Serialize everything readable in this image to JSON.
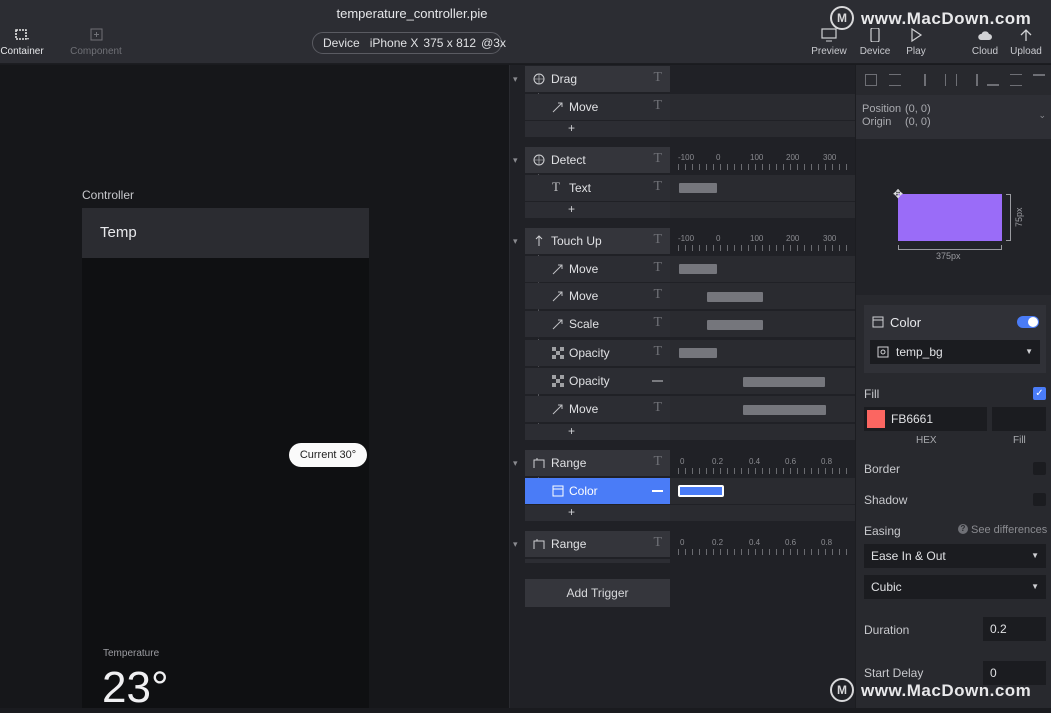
{
  "app": {
    "title": "temperature_controller.pie",
    "watermark": "www.MacDown.com",
    "watermark_logo": "M"
  },
  "toolbar_left": [
    {
      "name": "container",
      "label": "Container",
      "icon": "container-icon"
    },
    {
      "name": "component",
      "label": "Component",
      "icon": "component-icon"
    }
  ],
  "device_selector": {
    "label": "Device",
    "model": "iPhone X",
    "size": "375 x 812",
    "scale": "@3x"
  },
  "toolbar_right": [
    {
      "name": "preview",
      "label": "Preview",
      "icon": "preview-icon"
    },
    {
      "name": "device",
      "label": "Device",
      "icon": "device-icon"
    },
    {
      "name": "play",
      "label": "Play",
      "icon": "play-icon"
    },
    {
      "name": "cloud",
      "label": "Cloud",
      "icon": "cloud-icon"
    },
    {
      "name": "upload",
      "label": "Upload",
      "icon": "upload-icon"
    }
  ],
  "canvas": {
    "container_label": "Controller",
    "header_title": "Temp",
    "tooltip": "Current 30°",
    "temperature_label": "Temperature",
    "temperature_value": "23°"
  },
  "timeline": {
    "triggers": [
      {
        "name": "Drag",
        "icon": "drag-icon",
        "actions": [
          {
            "name": "Move",
            "icon": "move-icon"
          }
        ]
      },
      {
        "name": "Detect",
        "icon": "detect-icon",
        "actions": [
          {
            "name": "Text",
            "icon": "text-icon"
          }
        ]
      },
      {
        "name": "Touch Up",
        "icon": "touch-up-icon",
        "actions": [
          {
            "name": "Move",
            "icon": "move-icon"
          },
          {
            "name": "Move",
            "icon": "move-icon"
          },
          {
            "name": "Scale",
            "icon": "scale-icon"
          },
          {
            "name": "Opacity",
            "icon": "opacity-icon"
          },
          {
            "name": "Opacity",
            "icon": "opacity-icon"
          },
          {
            "name": "Move",
            "icon": "move-icon"
          }
        ]
      },
      {
        "name": "Range",
        "icon": "range-icon",
        "actions": [
          {
            "name": "Color",
            "icon": "color-icon"
          }
        ]
      },
      {
        "name": "Range",
        "icon": "range-icon",
        "actions": []
      }
    ],
    "ruler_ms": [
      "-100",
      "0",
      "100",
      "200",
      "300"
    ],
    "ruler_range": [
      "0",
      "0.2",
      "0.4",
      "0.6",
      "0.8"
    ],
    "type_glyph": "T",
    "add_symbol": "+",
    "add_trigger_label": "Add Trigger"
  },
  "inspector": {
    "position_label": "Position",
    "position_value": "(0, 0)",
    "origin_label": "Origin",
    "origin_value": "(0, 0)",
    "preview_width": "375px",
    "preview_height": "75px",
    "preview_color": "#9a6cf8",
    "color_section": "Color",
    "color_toggle_on": true,
    "color_target": "temp_bg",
    "fill_label": "Fill",
    "fill_checked": true,
    "fill_hex": "FB6661",
    "fill_swatch": "#fb6661",
    "hex_caption": "HEX",
    "fill_caption": "Fill",
    "border_label": "Border",
    "shadow_label": "Shadow",
    "easing_label": "Easing",
    "see_differences": "See differences",
    "easing_value": "Ease In & Out",
    "curve_value": "Cubic",
    "duration_label": "Duration",
    "duration_value": "0.2",
    "delay_label": "Start Delay",
    "delay_value": "0"
  },
  "colors": {
    "accent": "#4a7cf7",
    "toolbar": "#2c2d33",
    "canvas": "#16171a"
  }
}
